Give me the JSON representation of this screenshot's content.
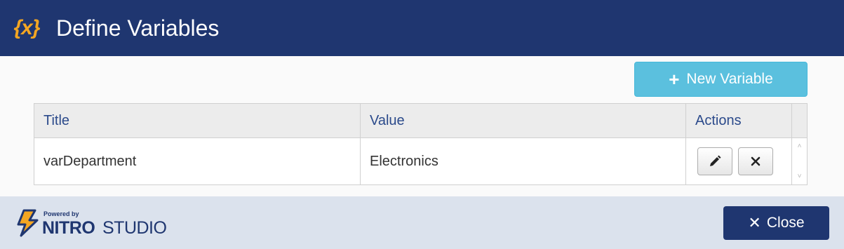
{
  "header": {
    "icon_text": "{x}",
    "title": "Define Variables"
  },
  "toolbar": {
    "new_variable_label": "New Variable",
    "plus_glyph": "+"
  },
  "grid": {
    "columns": [
      "Title",
      "Value",
      "Actions"
    ],
    "rows": [
      {
        "title": "varDepartment",
        "value": "Electronics"
      }
    ]
  },
  "footer": {
    "brand_powered": "Powered by",
    "brand_nitro": "NITRO",
    "brand_studio": "STUDIO",
    "close_label": "Close",
    "close_glyph": "✕"
  },
  "colors": {
    "header_bg": "#1f3670",
    "accent_icon": "#f4a622",
    "info_button": "#5bc0de",
    "footer_bg": "#dbe2ed"
  }
}
